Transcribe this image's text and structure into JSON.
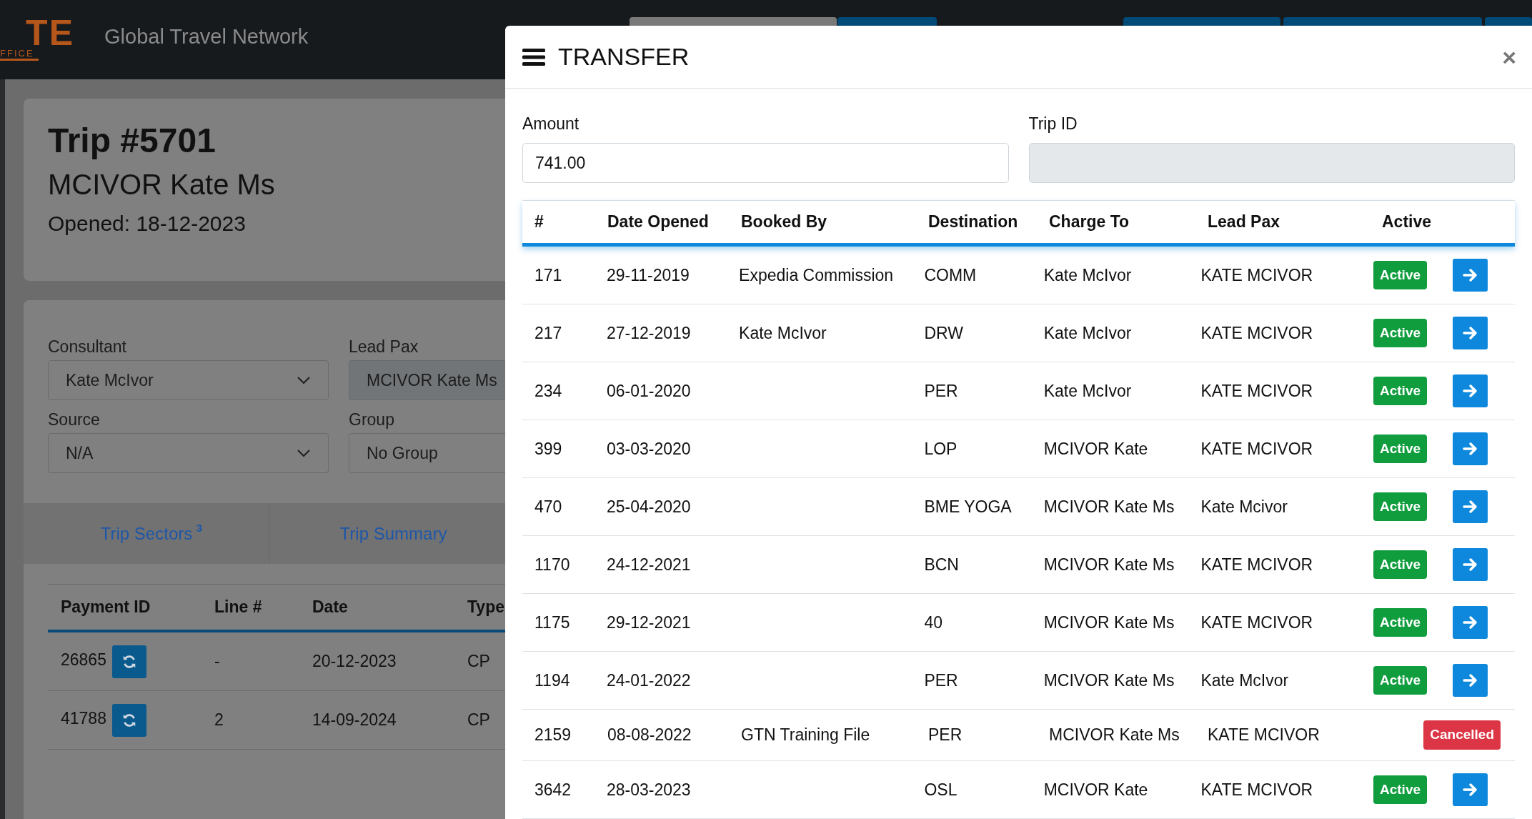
{
  "header": {
    "logo_main": "TE",
    "logo_sub": "FFICE",
    "title": "Global Travel Network"
  },
  "trip": {
    "title": "Trip #5701",
    "name": "MCIVOR Kate Ms",
    "opened": "Opened: 18-12-2023"
  },
  "form": {
    "fields": [
      {
        "label": "Consultant",
        "value": "Kate McIvor",
        "kind": "select"
      },
      {
        "label": "Lead Pax",
        "value": "MCIVOR Kate Ms",
        "kind": "readonly"
      },
      {
        "label": "Source",
        "value": "N/A",
        "kind": "select"
      },
      {
        "label": "Group",
        "value": "No Group",
        "kind": "text"
      }
    ]
  },
  "tabs": [
    {
      "label": "Trip Sectors",
      "badge": "3",
      "selected": false
    },
    {
      "label": "Trip Summary",
      "selected": false
    }
  ],
  "payments": {
    "columns": [
      "Payment ID",
      "Line #",
      "Date",
      "Type"
    ],
    "rows": [
      {
        "id": "26865",
        "line": "-",
        "date": "20-12-2023",
        "type": "CP"
      },
      {
        "id": "41788",
        "line": "2",
        "date": "14-09-2024",
        "type": "CP"
      }
    ]
  },
  "modal": {
    "title": "TRANSFER",
    "close": "×",
    "amount_label": "Amount",
    "amount_value": "741.00",
    "trip_id_label": "Trip ID",
    "columns": [
      "#",
      "Date Opened",
      "Booked By",
      "Destination",
      "Charge To",
      "Lead Pax",
      "Active"
    ],
    "rows": [
      {
        "num": "171",
        "date": "29-11-2019",
        "booked_by": "Expedia Commission",
        "destination": "COMM",
        "charge_to": "Kate McIvor",
        "lead_pax": "KATE MCIVOR",
        "status": {
          "kind": "active",
          "label": "Active"
        },
        "transfer_button": true
      },
      {
        "num": "217",
        "date": "27-12-2019",
        "booked_by": "Kate McIvor",
        "destination": "DRW",
        "charge_to": "Kate McIvor",
        "lead_pax": "KATE MCIVOR",
        "status": {
          "kind": "active",
          "label": "Active"
        },
        "transfer_button": true
      },
      {
        "num": "234",
        "date": "06-01-2020",
        "destination": "PER",
        "charge_to": "Kate McIvor",
        "lead_pax": "KATE MCIVOR",
        "status": {
          "kind": "active",
          "label": "Active"
        },
        "transfer_button": true
      },
      {
        "num": "399",
        "date": "03-03-2020",
        "destination": "LOP",
        "charge_to": "MCIVOR Kate",
        "lead_pax": "KATE MCIVOR",
        "status": {
          "kind": "active",
          "label": "Active"
        },
        "transfer_button": true
      },
      {
        "num": "470",
        "date": "25-04-2020",
        "destination": "BME YOGA",
        "charge_to": "MCIVOR Kate Ms",
        "lead_pax": "Kate Mcivor",
        "status": {
          "kind": "active",
          "label": "Active"
        },
        "transfer_button": true
      },
      {
        "num": "1170",
        "date": "24-12-2021",
        "destination": "BCN",
        "charge_to": "MCIVOR Kate Ms",
        "lead_pax": "KATE MCIVOR",
        "status": {
          "kind": "active",
          "label": "Active"
        },
        "transfer_button": true
      },
      {
        "num": "1175",
        "date": "29-12-2021",
        "destination": "40",
        "charge_to": "MCIVOR Kate Ms",
        "lead_pax": "KATE MCIVOR",
        "status": {
          "kind": "active",
          "label": "Active"
        },
        "transfer_button": true
      },
      {
        "num": "1194",
        "date": "24-01-2022",
        "destination": "PER",
        "charge_to": "MCIVOR Kate Ms",
        "lead_pax": "Kate McIvor",
        "status": {
          "kind": "active",
          "label": "Active"
        },
        "transfer_button": true
      },
      {
        "num": "2159",
        "date": "08-08-2022",
        "booked_by": "GTN Training File",
        "destination": "PER",
        "charge_to": "MCIVOR Kate Ms",
        "lead_pax": "KATE MCIVOR",
        "status": {
          "kind": "cancelled",
          "label": "Cancelled"
        },
        "transfer_button": false
      },
      {
        "num": "3642",
        "date": "28-03-2023",
        "destination": "OSL",
        "charge_to": "MCIVOR Kate",
        "lead_pax": "KATE MCIVOR",
        "status": {
          "kind": "active",
          "label": "Active"
        },
        "transfer_button": true
      }
    ]
  }
}
